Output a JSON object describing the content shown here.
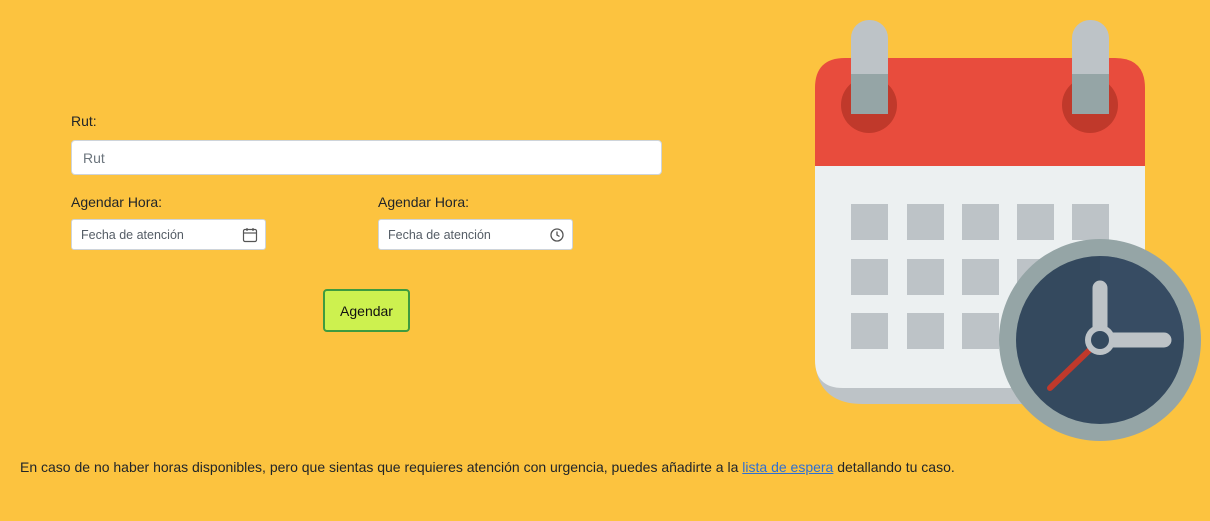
{
  "form": {
    "rut_label": "Rut:",
    "rut_placeholder": "Rut",
    "date_label": "Agendar Hora:",
    "date_placeholder": "Fecha de atención",
    "time_label": "Agendar Hora:",
    "time_placeholder": "Fecha de atención",
    "submit_label": "Agendar"
  },
  "footer": {
    "text_before": "En caso de no haber horas disponibles, pero que sientas que requieres atención con urgencia, puedes añadirte a la ",
    "link_text": "lista de espera",
    "text_after": " detallando tu caso."
  },
  "icons": {
    "date_icon": "calendar-icon",
    "time_icon": "clock-icon",
    "illustration": "calendar-clock-illustration"
  },
  "colors": {
    "background": "#fcc33f",
    "button_bg": "#cdf14f",
    "button_border": "#3e9b3f",
    "link": "#2d6fd4",
    "calendar_header": "#e84c3d",
    "clock_face": "#34495e"
  }
}
